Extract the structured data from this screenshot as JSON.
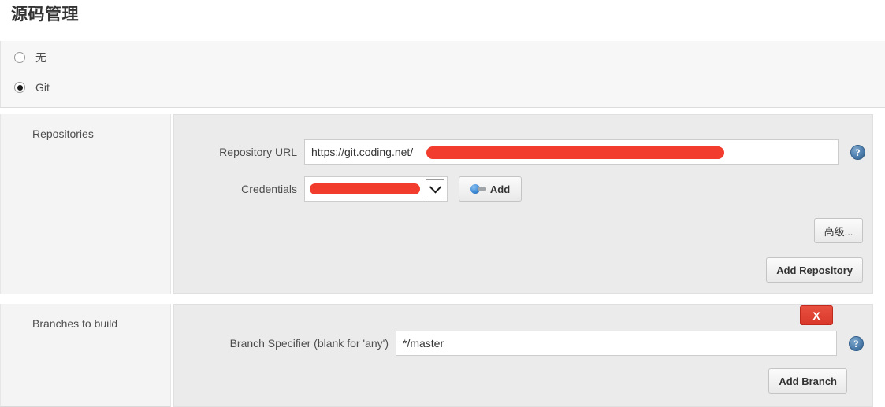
{
  "header": {
    "title": "源码管理"
  },
  "scm_type": {
    "options": [
      {
        "label": "无",
        "selected": false
      },
      {
        "label": "Git",
        "selected": true
      }
    ]
  },
  "repositories": {
    "section_label": "Repositories",
    "repository_url": {
      "label": "Repository URL",
      "value": "https://git.coding.net/",
      "redacted": true
    },
    "credentials": {
      "label": "Credentials",
      "selected_value": "",
      "redacted": true,
      "arrow_icon": "chevron-down-icon"
    },
    "add_credentials_button": {
      "label": "Add",
      "icon": "key-icon",
      "caret_icon": "caret-down-icon"
    },
    "advanced_button": "高级...",
    "add_repository_button": "Add Repository",
    "help_icon": "help-icon"
  },
  "branches": {
    "section_label": "Branches to build",
    "delete_button": "X",
    "branch_specifier": {
      "label": "Branch Specifier (blank for 'any')",
      "value": "*/master"
    },
    "add_branch_button": "Add Branch",
    "help_icon": "help-icon"
  },
  "colors": {
    "redaction": "#f23d2e",
    "danger": "#d9382a",
    "help_blue": "#4f7fae",
    "panel_bg": "#ebebeb",
    "left_col_bg": "#f4f4f4"
  }
}
